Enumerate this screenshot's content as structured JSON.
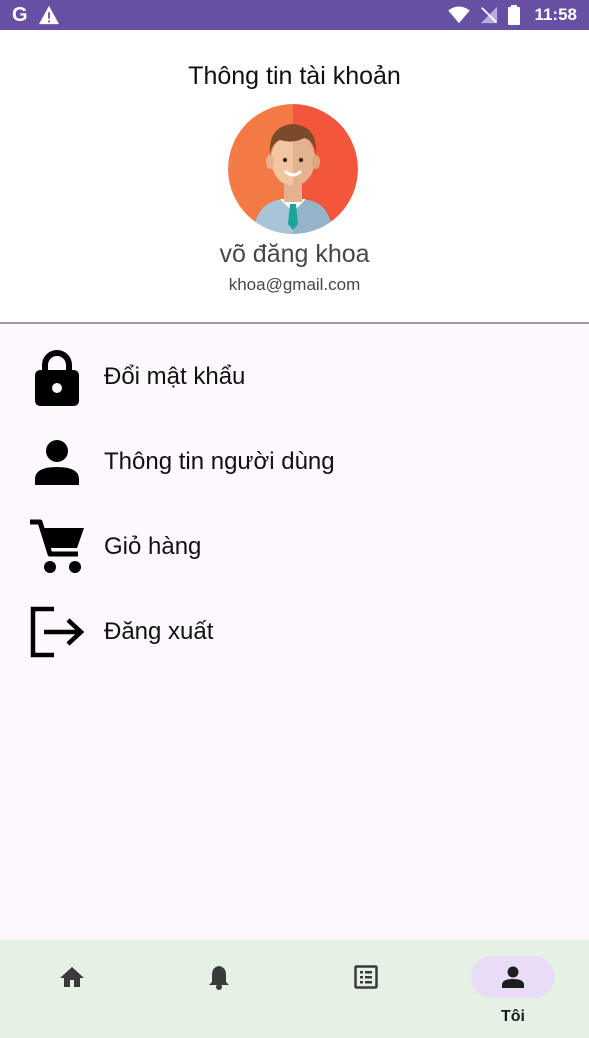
{
  "status_bar": {
    "left_icons": [
      "google-icon",
      "warning-icon"
    ],
    "right_icons": [
      "wifi-icon",
      "no-signal-icon",
      "battery-icon"
    ],
    "time": "11:58",
    "google_glyph": "G"
  },
  "header": {
    "title": "Thông tin tài khoản",
    "user_name": "võ đăng khoa",
    "user_email": "khoa@gmail.com"
  },
  "menu": {
    "items": [
      {
        "label": "Đổi mật khẩu",
        "icon": "lock-icon"
      },
      {
        "label": "Thông tin người dùng",
        "icon": "person-icon"
      },
      {
        "label": "Giỏ hàng",
        "icon": "cart-icon"
      },
      {
        "label": "Đăng xuất",
        "icon": "logout-icon"
      }
    ]
  },
  "bottom_nav": {
    "items": [
      {
        "icon": "home-icon",
        "label": ""
      },
      {
        "icon": "bell-icon",
        "label": ""
      },
      {
        "icon": "list-icon",
        "label": ""
      },
      {
        "icon": "person-icon",
        "label": "Tôi",
        "active": true
      }
    ]
  },
  "colors": {
    "status_bar": "#6750a4",
    "nav_background": "#e6f1e6",
    "active_pill": "#e9dcf6"
  }
}
